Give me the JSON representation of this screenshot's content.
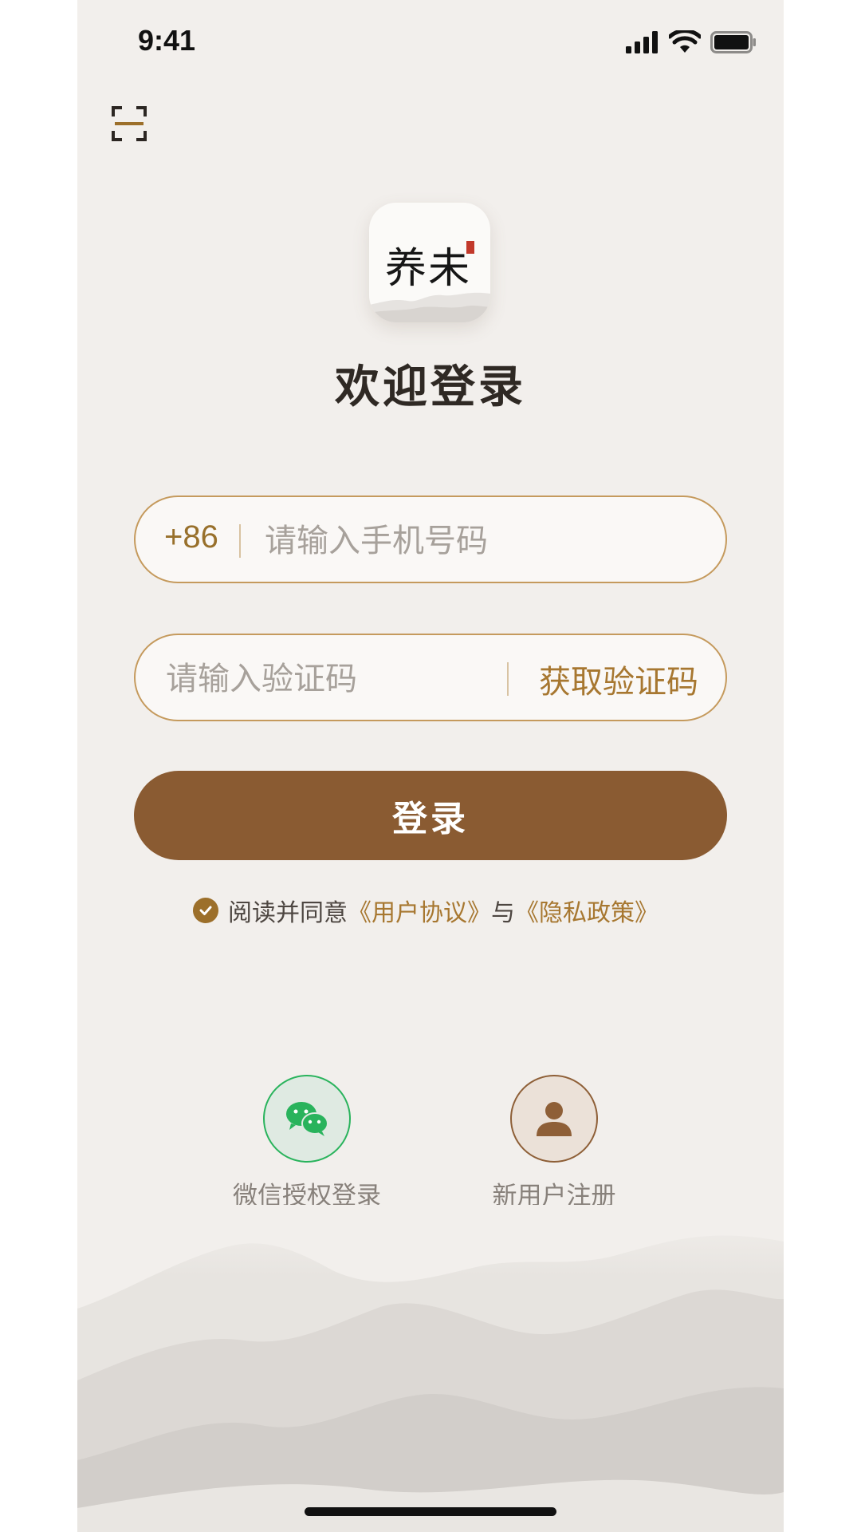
{
  "status_bar": {
    "time": "9:41"
  },
  "icons": {
    "scan": "scan-icon",
    "signal": "cellular-signal-icon",
    "wifi": "wifi-icon",
    "battery": "battery-icon",
    "wechat": "wechat-icon",
    "person": "person-icon",
    "check": "check-icon"
  },
  "logo": {
    "text": "养未"
  },
  "title": "欢迎登录",
  "phone_field": {
    "prefix": "+86",
    "placeholder": "请输入手机号码"
  },
  "code_field": {
    "placeholder": "请输入验证码",
    "get_code_label": "获取验证码"
  },
  "login_button": {
    "label": "登录"
  },
  "agreement": {
    "text": "阅读并同意",
    "user_agreement": "《用户协议》",
    "connector": "与",
    "privacy_policy": "《隐私政策》"
  },
  "social": {
    "wechat_label": "微信授权登录",
    "register_label": "新用户注册"
  },
  "colors": {
    "background": "#f2efec",
    "brand_brown": "#8a5b32",
    "gold_text": "#a77730",
    "field_border": "#c59a5d",
    "wechat_green": "#29b35c"
  }
}
